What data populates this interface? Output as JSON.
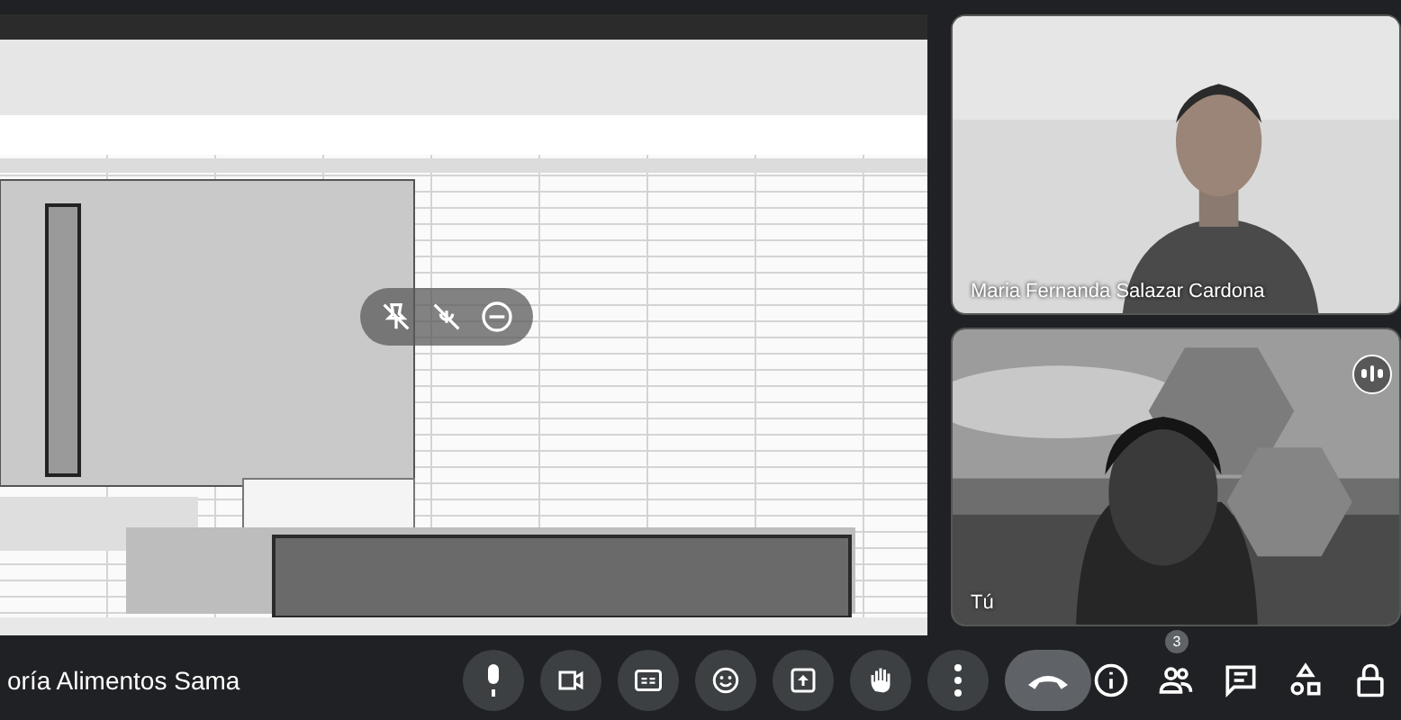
{
  "participants": [
    {
      "name": "Maria Fernanda Salazar Cardona",
      "speaking": false
    },
    {
      "name": "Tú",
      "speaking": true
    }
  ],
  "meeting_title": "oría Alimentos Sama",
  "people_count": "3"
}
